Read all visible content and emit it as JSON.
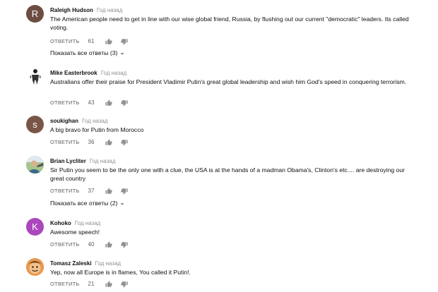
{
  "comments": [
    {
      "author": "Raleigh Hudson",
      "time": "Год назад",
      "text": "The American people need to get in line with our wise global friend, Russia, by flushing out our current \"democratic\" leaders. Its called voting.",
      "reply_label": "ОТВЕТИТЬ",
      "likes": "61",
      "avatar_letter": "R",
      "avatar_color": "#6d4c41",
      "show_replies": "Показать все ответы (3)"
    },
    {
      "author": "Mike Easterbrook",
      "time": "Год назад",
      "text": "Australians offer their praise for President Vladimir Putin's great global leadership and wish him God's speed in conquering terrorism.",
      "reply_label": "ОТВЕТИТЬ",
      "likes": "43"
    },
    {
      "author": "soukighan",
      "time": "Год назад",
      "text": "A big bravo for Putin from Morocco",
      "reply_label": "ОТВЕТИТЬ",
      "likes": "36",
      "avatar_letter": "s",
      "avatar_color": "#795548"
    },
    {
      "author": "Brian Lycliter",
      "time": "Год назад",
      "text": "Sir Putin you seem to be the only one with a clue, the USA is at the hands of a madman Obama's, Clinton's etc.... are destroying our great country",
      "reply_label": "ОТВЕТИТЬ",
      "likes": "37",
      "show_replies": "Показать все ответы (2)"
    },
    {
      "author": "Kohoko",
      "time": "Год назад",
      "text": "Awesome speech!",
      "reply_label": "ОТВЕТИТЬ",
      "likes": "40",
      "avatar_letter": "K",
      "avatar_color": "#ab47bc"
    },
    {
      "author": "Tomasz Zaleski",
      "time": "Год назад",
      "text": "Yep, now all Europe is in flames, You called it Putin!.",
      "reply_label": "ОТВЕТИТЬ",
      "likes": "21"
    }
  ],
  "icons": {
    "like": "thumb-up-icon",
    "dislike": "thumb-down-icon",
    "chevron": "chevron-down-icon"
  }
}
